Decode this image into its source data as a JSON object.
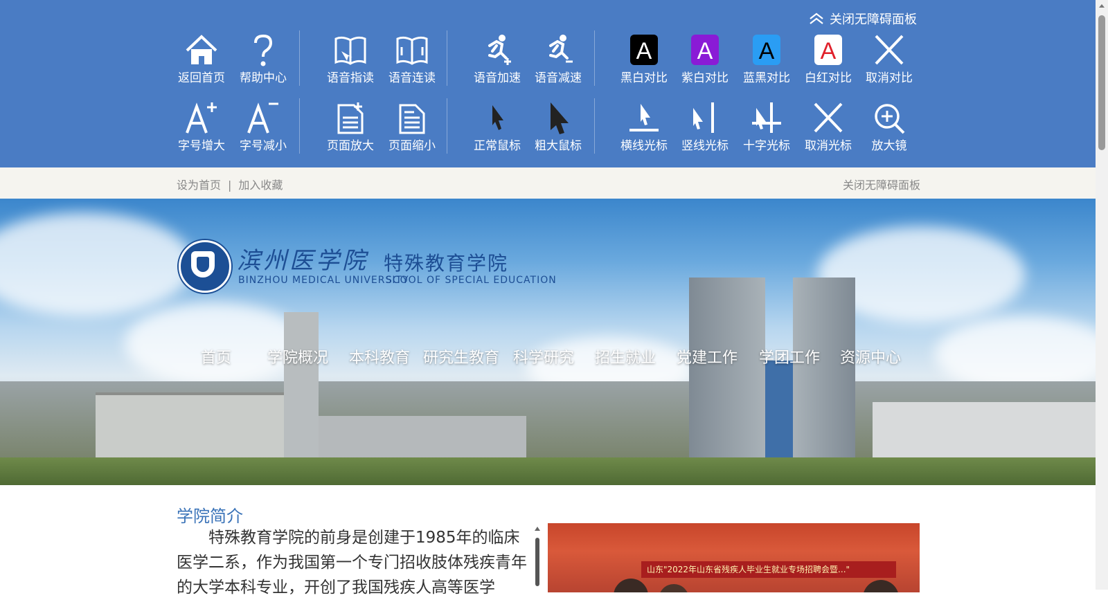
{
  "panel": {
    "close_label": "关闭无障碍面板",
    "tools_row1": [
      {
        "label": "返回首页",
        "icon": "home-icon"
      },
      {
        "label": "帮助中心",
        "icon": "help-icon"
      },
      {
        "label": "语音指读",
        "icon": "book-pointer-icon"
      },
      {
        "label": "语音连读",
        "icon": "book-open-icon"
      },
      {
        "label": "语音加速",
        "icon": "runner-plus-icon"
      },
      {
        "label": "语音减速",
        "icon": "runner-minus-icon"
      },
      {
        "label": "黑白对比",
        "icon": "contrast-black-white-icon"
      },
      {
        "label": "紫白对比",
        "icon": "contrast-purple-white-icon"
      },
      {
        "label": "蓝黑对比",
        "icon": "contrast-blue-black-icon"
      },
      {
        "label": "白红对比",
        "icon": "contrast-white-red-icon"
      },
      {
        "label": "取消对比",
        "icon": "cancel-contrast-icon"
      }
    ],
    "tools_row2": [
      {
        "label": "字号增大",
        "icon": "font-increase-icon"
      },
      {
        "label": "字号减小",
        "icon": "font-decrease-icon"
      },
      {
        "label": "页面放大",
        "icon": "page-zoom-in-icon"
      },
      {
        "label": "页面缩小",
        "icon": "page-zoom-out-icon"
      },
      {
        "label": "正常鼠标",
        "icon": "cursor-normal-icon"
      },
      {
        "label": "粗大鼠标",
        "icon": "cursor-large-icon"
      },
      {
        "label": "横线光标",
        "icon": "cursor-hline-icon"
      },
      {
        "label": "竖线光标",
        "icon": "cursor-vline-icon"
      },
      {
        "label": "十字光标",
        "icon": "cursor-cross-icon"
      },
      {
        "label": "取消光标",
        "icon": "cancel-cursor-icon"
      },
      {
        "label": "放大镜",
        "icon": "magnifier-icon"
      }
    ],
    "contrast_letter": "A"
  },
  "subbar": {
    "set_home": "设为首页",
    "separator": "|",
    "bookmark": "加入收藏",
    "close_panel": "关闭无障碍面板"
  },
  "logo": {
    "university_cn": "滨州医学院",
    "university_en": "BINZHOU MEDICAL UNIVERSITY",
    "school_cn": "特殊教育学院",
    "school_en": "SCOOL OF SPECIAL EDUCATION"
  },
  "nav": [
    "首页",
    "学院概况",
    "本科教育",
    "研究生教育",
    "科学研究",
    "招生就业",
    "党建工作",
    "学团工作",
    "资源中心"
  ],
  "intro": {
    "title": "学院简介",
    "text": "特殊教育学院的前身是创建于1985年的临床医学二系，作为我国第一个专门招收肢体残疾青年的大学本科专业，开创了我国残疾人高等医学"
  },
  "photo": {
    "banner_text": "山东\"2022年山东省残疾人毕业生就业专场招聘会暨...\""
  },
  "colors": {
    "panel_bg": "#4a7cc4",
    "accent": "#3a73b8",
    "subbar_bg": "#f5f4ef"
  }
}
